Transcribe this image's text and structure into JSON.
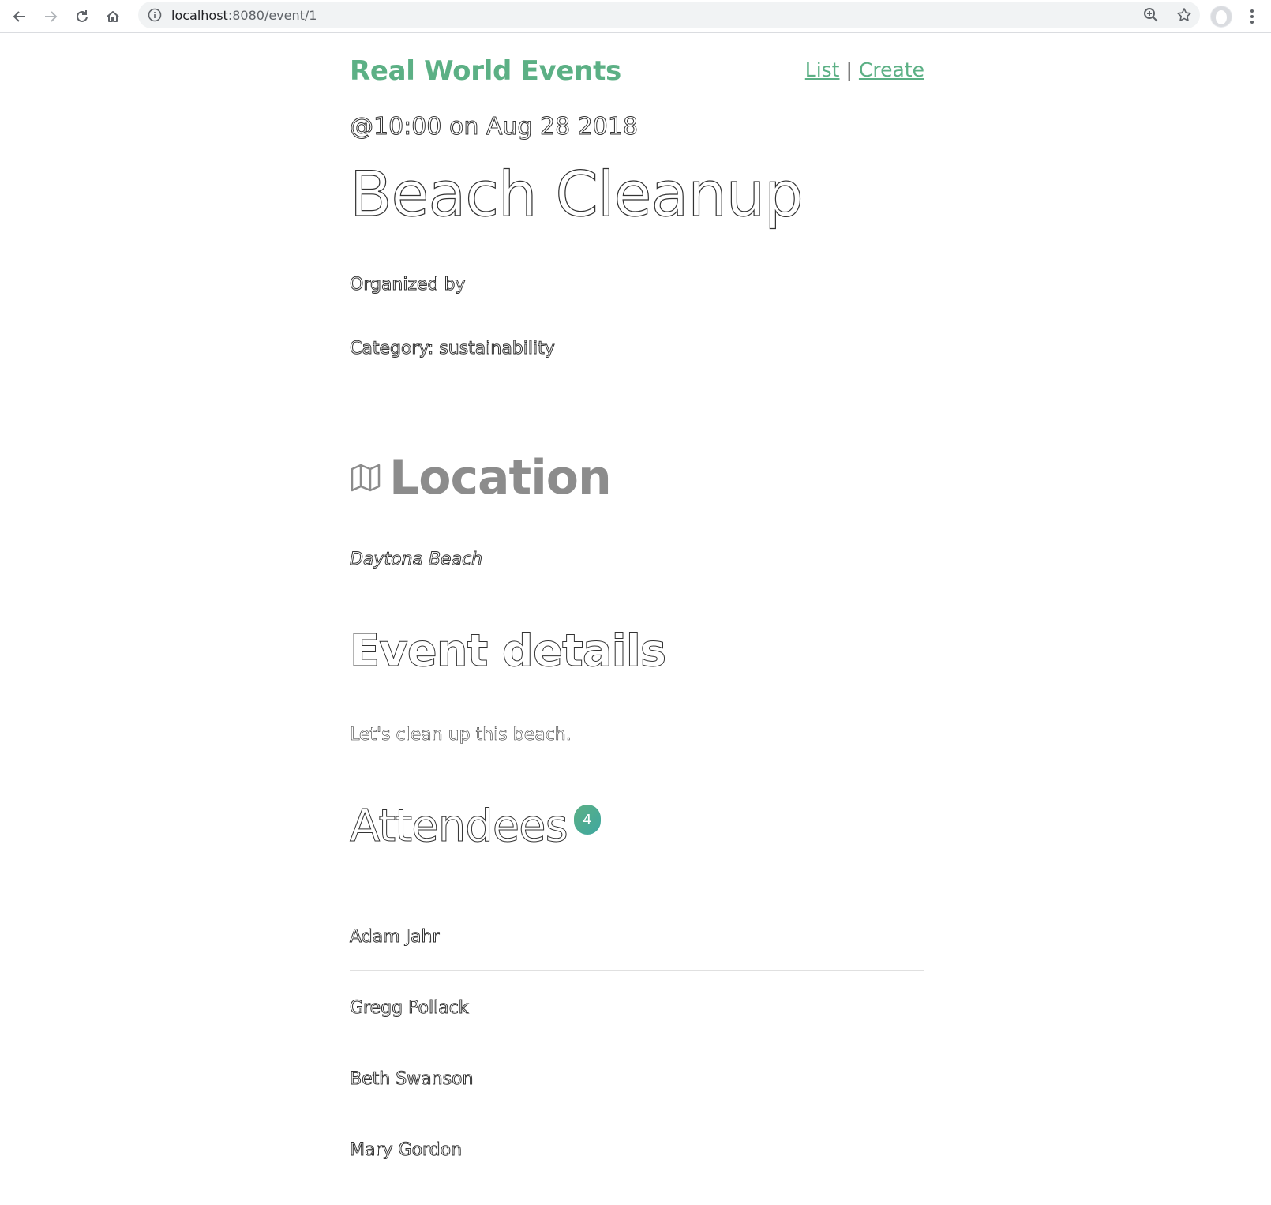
{
  "browser": {
    "url_host": "localhost",
    "url_path": ":8080/event/1"
  },
  "nav": {
    "brand": "Real World Events",
    "links": [
      "List",
      "Create"
    ],
    "separator": "|"
  },
  "event": {
    "datetime": "@10:00 on Aug 28 2018",
    "title": "Beach Cleanup",
    "organized_by": "Organized by",
    "category": "Category: sustainability",
    "location_heading": "Location",
    "location": "Daytona Beach",
    "details_heading": "Event details",
    "description": "Let's clean up this beach.",
    "attendees_heading": "Attendees",
    "attendee_count": "4",
    "attendees": [
      "Adam Jahr",
      "Gregg Pollack",
      "Beth Swanson",
      "Mary Gordon"
    ]
  },
  "colors": {
    "accent": "#5cb085",
    "muted_heading": "#8c8c8c"
  }
}
